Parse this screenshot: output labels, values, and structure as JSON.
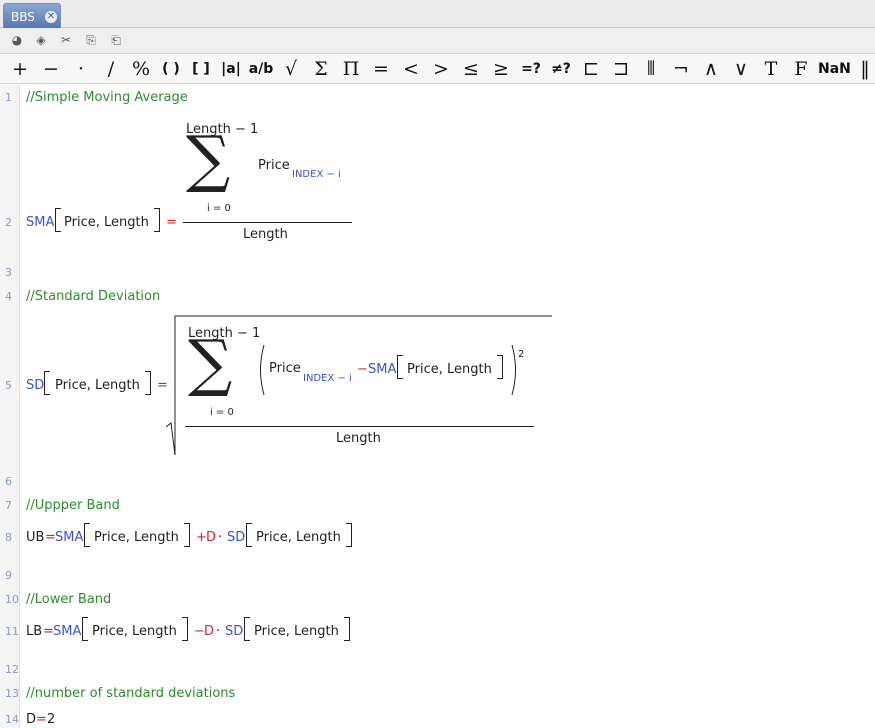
{
  "tab": {
    "title": "BBS",
    "close": "✕"
  },
  "toolbar1": [
    {
      "name": "open-icon",
      "glyph": "◕"
    },
    {
      "name": "save-icon",
      "glyph": "◈"
    },
    {
      "name": "cut-icon",
      "glyph": "✂"
    },
    {
      "name": "copy-icon",
      "glyph": "⎘"
    },
    {
      "name": "paste-icon",
      "glyph": "⎗"
    }
  ],
  "symbols": [
    "+",
    "−",
    "·",
    "/",
    "%",
    "( )",
    "[ ]",
    "|a|",
    "a/b",
    "√",
    "Σ",
    "Π",
    "=",
    "<",
    ">",
    "≤",
    "≥",
    "=?",
    "≠?",
    "⊏",
    "⊐",
    "⦀",
    "¬",
    "∧",
    "∨",
    "T",
    "F",
    "NaN",
    "‖"
  ],
  "lines": [
    "1",
    "2",
    "3",
    "4",
    "5",
    "6",
    "7",
    "8",
    "9",
    "10",
    "11",
    "12",
    "13",
    "14"
  ],
  "code": {
    "c1": "//Simple Moving Average",
    "sma": "SMA",
    "eq": "=",
    "args": "Price, Length",
    "upper": "Length − 1",
    "lower": "i = 0",
    "price": "Price",
    "sub": "INDEX − i",
    "den": "Length",
    "c4": "//Standard Deviation",
    "sd": "SD",
    "minus": "−",
    "sq": "2",
    "c7": "//Uppper Band",
    "ub": "UB",
    "plus": "+",
    "d": "D",
    "dot": "·",
    "c10": "//Lower Band",
    "lb": "LB",
    "c13": "//number of standard deviations",
    "dval": "2"
  }
}
